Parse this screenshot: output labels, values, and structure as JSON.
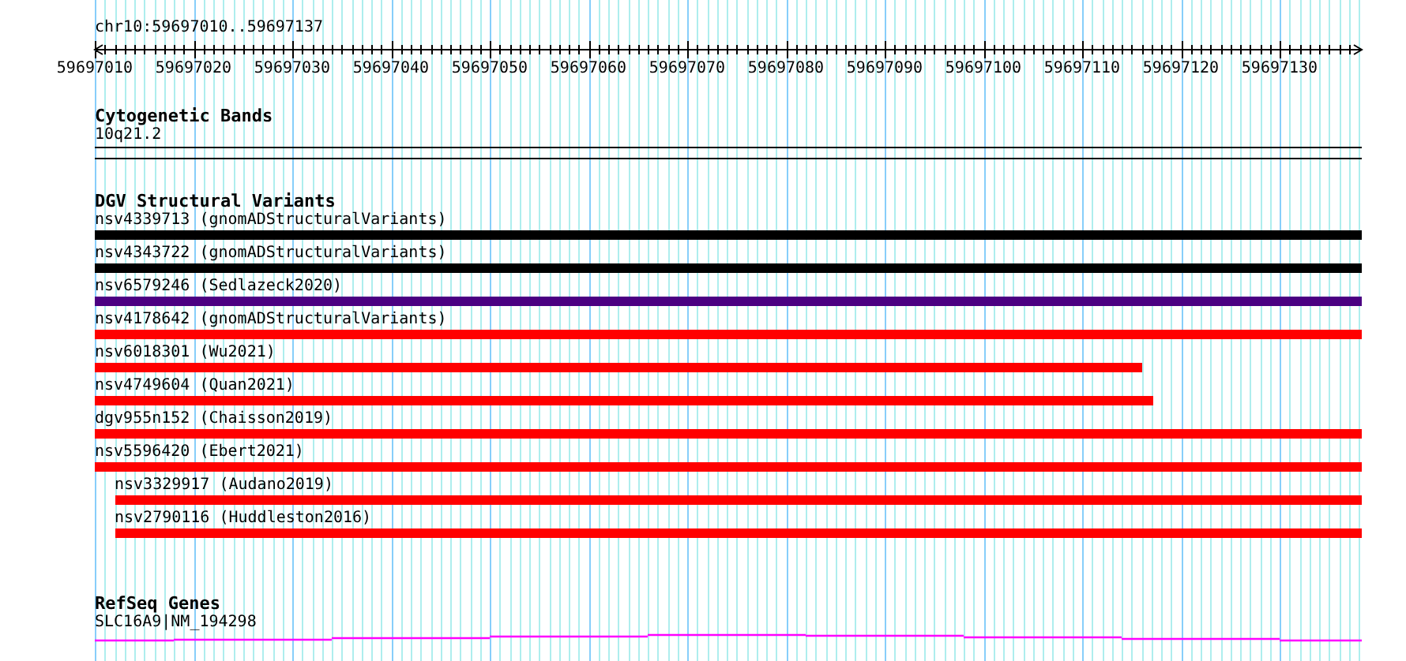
{
  "ruler": {
    "location": "chr10:59697010..59697137",
    "ticks": [
      "59697010",
      "59697020",
      "59697030",
      "59697040",
      "59697050",
      "59697060",
      "59697070",
      "59697080",
      "59697090",
      "59697100",
      "59697110",
      "59697120",
      "59697130"
    ]
  },
  "tracks": [
    {
      "kind": "band",
      "title": "Cytogenetic Bands",
      "features": [
        {
          "label": "10q21.2"
        }
      ]
    },
    {
      "kind": "variants",
      "title": "DGV Structural Variants",
      "features": [
        {
          "label": "nsv4339713 (gnomADStructuralVariants)",
          "color": "#000000",
          "starts_in_view": false,
          "level": 1
        },
        {
          "label": "nsv4343722 (gnomADStructuralVariants)",
          "color": "#000000",
          "starts_in_view": false,
          "level": 1
        },
        {
          "label": "nsv6579246 (Sedlazeck2020)",
          "color": "#4b0082",
          "starts_in_view": false,
          "level": 1
        },
        {
          "label": "nsv4178642 (gnomADStructuralVariants)",
          "color": "#ff0000",
          "starts_in_view": false,
          "level": 1
        },
        {
          "label": "nsv6018301 (Wu2021)",
          "color": "#ff0000",
          "starts_in_view": false,
          "level": 0.827
        },
        {
          "label": "nsv4749604 (Quan2021)",
          "color": "#ff0000",
          "starts_in_view": false,
          "level": 0.835
        },
        {
          "label": "dgv955n152 (Chaisson2019)",
          "color": "#ff0000",
          "starts_in_view": false,
          "level": 1
        },
        {
          "label": "nsv5596420 (Ebert2021)",
          "color": "#ff0000",
          "starts_in_view": false,
          "level": 1
        },
        {
          "label": "nsv3329917 (Audano2019)",
          "color": "#ff0000",
          "starts_in_view": true,
          "level": 0.984
        },
        {
          "label": "nsv2790116 (Huddleston2016)",
          "color": "#ff0000",
          "starts_in_view": true,
          "level": 0.984
        }
      ]
    },
    {
      "kind": "gene",
      "title": "RefSeq Genes",
      "features": [
        {
          "label": "SLC16A9|NM_194298"
        }
      ]
    }
  ]
}
